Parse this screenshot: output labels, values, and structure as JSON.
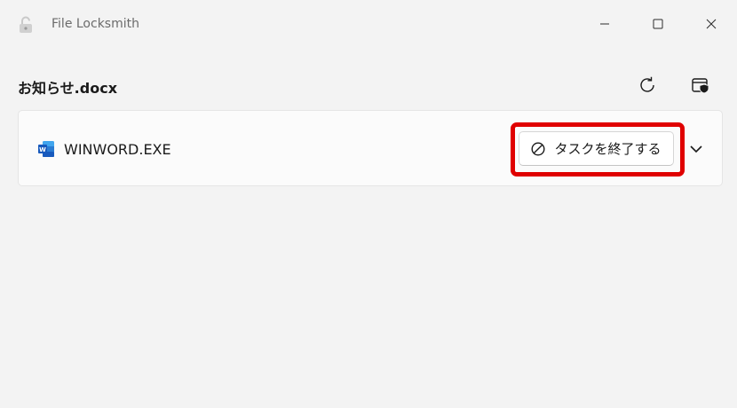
{
  "window": {
    "title": "File Locksmith",
    "controls": [
      "minimize",
      "maximize",
      "close"
    ]
  },
  "header": {
    "file_name": "お知らせ.docx",
    "refresh_icon": "refresh-icon",
    "admin_icon": "restart-as-admin-icon"
  },
  "processes": [
    {
      "name": "WINWORD.EXE",
      "icon": "word-icon",
      "end_task_label": "タスクを終了する",
      "expanded": false
    }
  ],
  "colors": {
    "background": "#f3f3f3",
    "card": "#fbfbfb",
    "highlight": "#e00000",
    "word_blue": "#185abd"
  }
}
